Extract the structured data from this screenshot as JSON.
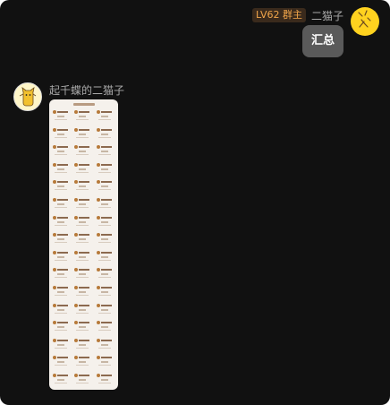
{
  "self_message": {
    "level_badge": "LV62 群主",
    "sender_name": "二猫子",
    "text": "汇总"
  },
  "other_message": {
    "sender_name": "起千蝶的二猫子",
    "image": {
      "kind": "long screenshot of a list",
      "columns": 3,
      "rows": 16
    }
  },
  "colors": {
    "background": "#111111",
    "badge_text": "#f0a54a",
    "bubble": "#5a5a5a",
    "avatar_self": "#ffd21f"
  }
}
